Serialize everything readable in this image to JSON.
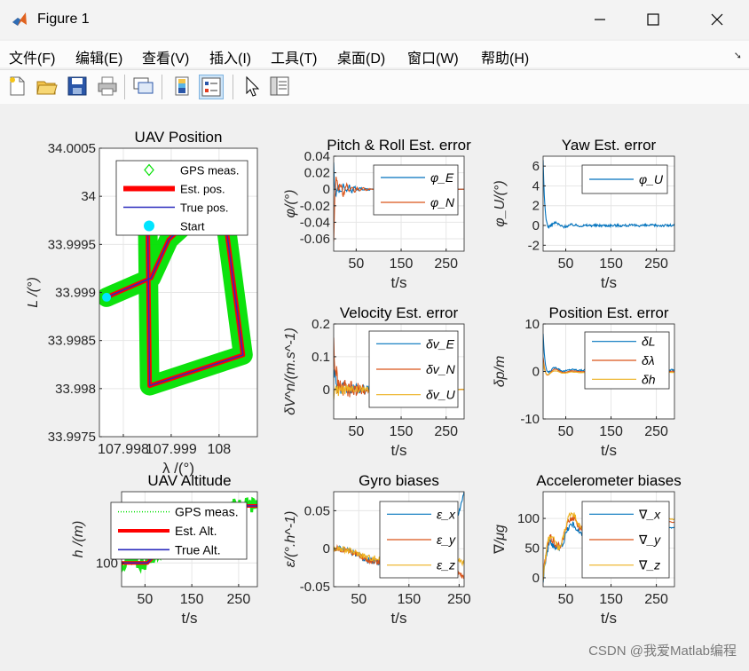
{
  "window": {
    "title": "Figure 1",
    "controls": [
      "minimize",
      "maximize",
      "close"
    ]
  },
  "menu": {
    "items": [
      "文件(F)",
      "编辑(E)",
      "查看(V)",
      "插入(I)",
      "工具(T)",
      "桌面(D)",
      "窗口(W)",
      "帮助(H)"
    ],
    "overflow_glyph": "➘"
  },
  "toolbar": {
    "buttons": [
      "new-figure",
      "open-file",
      "save",
      "print",
      "link-plot",
      "insert-colorbar",
      "insert-legend",
      "edit-plot",
      "property-inspector"
    ]
  },
  "watermark": "CSDN @我爱Matlab编程",
  "colors": {
    "gps": "#00e000",
    "est": "#ff0000",
    "true": "#2b2bbd",
    "start": "#00e5ff",
    "blue": "#0072BD",
    "orange": "#D95319",
    "yellow": "#EDB120"
  },
  "chart_data": [
    {
      "id": "uav-position",
      "type": "line",
      "title": "UAV Position",
      "xlabel": "λ /(°)",
      "ylabel": "L /(°)",
      "xlim": [
        107.9975,
        108.0008
      ],
      "ylim": [
        33.9975,
        34.0005
      ],
      "xticks": [
        107.998,
        107.999,
        108
      ],
      "xtick_labels": [
        "107.998",
        "107.999",
        "108"
      ],
      "yticks": [
        33.9975,
        33.998,
        33.9985,
        33.999,
        33.9995,
        34,
        34.0005
      ],
      "ytick_labels": [
        "33.9975",
        "33.998",
        "33.9985",
        "33.999",
        "33.9995",
        "34",
        "34.0005"
      ],
      "grid": true,
      "legend": [
        "GPS meas.",
        "Est. pos.",
        "True pos.",
        "Start"
      ],
      "path": [
        [
          107.99765,
          33.99895
        ],
        [
          107.99858,
          33.99915
        ],
        [
          107.99895,
          33.99955
        ],
        [
          108.00005,
          34.00005
        ],
        [
          108.0005,
          33.99835
        ],
        [
          107.99855,
          33.99803
        ],
        [
          107.9985,
          34.0001
        ]
      ],
      "start": [
        107.99765,
        33.99895
      ]
    },
    {
      "id": "pitch-roll-error",
      "type": "line",
      "title": "Pitch & Roll Est. error",
      "xlabel": "t/s",
      "ylabel": "φ/(°)",
      "xlim": [
        0,
        290
      ],
      "ylim": [
        -0.075,
        0.04
      ],
      "xticks": [
        50,
        150,
        250
      ],
      "yticks": [
        0.04,
        0.02,
        0,
        -0.02,
        -0.04,
        -0.06
      ],
      "ytick_labels": [
        "0.04",
        "0.02",
        "0",
        "-0.02",
        "-0.04",
        "-0.06"
      ],
      "grid": true,
      "legend": [
        "φ_E",
        "φ_N"
      ],
      "series": [
        {
          "name": "φ_E",
          "color": "blue",
          "shape": "damped",
          "start": 0.03,
          "amp": -0.04,
          "tail": 0.0
        },
        {
          "name": "φ_N",
          "color": "orange",
          "shape": "damped",
          "start": -0.06,
          "amp": 0.05,
          "tail": 0.0
        }
      ]
    },
    {
      "id": "yaw-error",
      "type": "line",
      "title": "Yaw Est. error",
      "xlabel": "t/s",
      "ylabel": "φ_U/(°)",
      "xlim": [
        0,
        290
      ],
      "ylim": [
        -2.6,
        7
      ],
      "xticks": [
        50,
        150,
        250
      ],
      "yticks": [
        6,
        4,
        2,
        0,
        -2
      ],
      "ytick_labels": [
        "6",
        "4",
        "2",
        "0",
        "-2"
      ],
      "grid": true,
      "legend": [
        "φ_U"
      ],
      "series": [
        {
          "name": "φ_U",
          "color": "blue",
          "shape": "decay",
          "start": 6.5,
          "amp": -0.8,
          "tail": 0.0
        }
      ]
    },
    {
      "id": "velocity-error",
      "type": "line",
      "title": "Velocity Est. error",
      "xlabel": "t/s",
      "ylabel": "δV^n/(m.s^-1)",
      "xlim": [
        0,
        290
      ],
      "ylim": [
        -0.09,
        0.2
      ],
      "xticks": [
        50,
        150,
        250
      ],
      "yticks": [
        0.2,
        0.1,
        0
      ],
      "ytick_labels": [
        "0.2",
        "0.1",
        "0"
      ],
      "grid": true,
      "legend": [
        "δv_E",
        "δv_N",
        "δv_U"
      ],
      "series": [
        {
          "name": "δv_E",
          "color": "blue",
          "shape": "noisy",
          "start": 0.08,
          "amp": 0.03,
          "tail": 0.0
        },
        {
          "name": "δv_N",
          "color": "orange",
          "shape": "noisy",
          "start": 0.15,
          "amp": 0.04,
          "tail": 0.0
        },
        {
          "name": "δv_U",
          "color": "yellow",
          "shape": "noisy",
          "start": -0.02,
          "amp": 0.02,
          "tail": 0.0
        }
      ]
    },
    {
      "id": "position-error",
      "type": "line",
      "title": "Position Est. error",
      "xlabel": "t/s",
      "ylabel": "δp/m",
      "xlim": [
        0,
        290
      ],
      "ylim": [
        -10,
        10
      ],
      "xticks": [
        50,
        150,
        250
      ],
      "yticks": [
        10,
        0,
        -10
      ],
      "ytick_labels": [
        "10",
        "0",
        "-10"
      ],
      "grid": true,
      "legend": [
        "δL",
        "δλ",
        "δh"
      ],
      "series": [
        {
          "name": "δL",
          "color": "blue",
          "shape": "decay",
          "start": 8,
          "amp": -1.5,
          "tail": 0.3
        },
        {
          "name": "δλ",
          "color": "orange",
          "shape": "decay",
          "start": 3,
          "amp": -1.5,
          "tail": 0.0
        },
        {
          "name": "δh",
          "color": "yellow",
          "shape": "decay",
          "start": 2,
          "amp": -1.0,
          "tail": -0.2
        }
      ]
    },
    {
      "id": "uav-altitude",
      "type": "line",
      "title": "UAV Altitude",
      "xlabel": "t/s",
      "ylabel": "h /(m)",
      "xlim": [
        0,
        290
      ],
      "ylim": [
        90,
        130
      ],
      "xticks": [
        50,
        150,
        250
      ],
      "yticks": [
        100
      ],
      "ytick_labels": [
        "100"
      ],
      "grid": true,
      "legend": [
        "GPS meas.",
        "Est. Alt.",
        "True Alt."
      ],
      "profile": [
        [
          0,
          100
        ],
        [
          55,
          100
        ],
        [
          70,
          103
        ],
        [
          230,
          124
        ],
        [
          290,
          124
        ]
      ]
    },
    {
      "id": "gyro-biases",
      "type": "line",
      "title": "Gyro biases",
      "xlabel": "t/s",
      "ylabel": "ε/(°.h^-1)",
      "xlim": [
        0,
        260
      ],
      "ylim": [
        -0.05,
        0.075
      ],
      "xticks": [
        50,
        150,
        250
      ],
      "yticks": [
        0.05,
        0,
        -0.05
      ],
      "ytick_labels": [
        "0.05",
        "0",
        "-0.05"
      ],
      "grid": true,
      "legend": [
        "ε_x",
        "ε_y",
        "ε_z"
      ],
      "series": [
        {
          "name": "ε_x",
          "color": "blue",
          "shape": "drift",
          "start": 0.0,
          "amp": -0.02,
          "tail": 0.07
        },
        {
          "name": "ε_y",
          "color": "orange",
          "shape": "drift",
          "start": 0.0,
          "amp": -0.02,
          "tail": -0.04
        },
        {
          "name": "ε_z",
          "color": "yellow",
          "shape": "drift",
          "start": 0.0,
          "amp": -0.015,
          "tail": -0.02
        }
      ]
    },
    {
      "id": "accelerometer-biases",
      "type": "line",
      "title": "Accelerometer biases",
      "xlabel": "t/s",
      "ylabel": "∇/μg",
      "xlim": [
        0,
        290
      ],
      "ylim": [
        -15,
        145
      ],
      "xticks": [
        50,
        150,
        250
      ],
      "yticks": [
        100,
        50,
        0
      ],
      "ytick_labels": [
        "100",
        "50",
        "0"
      ],
      "grid": true,
      "legend": [
        "∇_x",
        "∇_y",
        "∇_z"
      ],
      "series": [
        {
          "name": "∇_x",
          "color": "blue",
          "shape": "rise",
          "start": 0,
          "amp": 80,
          "tail": 85
        },
        {
          "name": "∇_y",
          "color": "orange",
          "shape": "rise",
          "start": 0,
          "amp": 90,
          "tail": 95
        },
        {
          "name": "∇_z",
          "color": "yellow",
          "shape": "rise",
          "start": -10,
          "amp": 120,
          "tail": 100
        }
      ]
    }
  ]
}
